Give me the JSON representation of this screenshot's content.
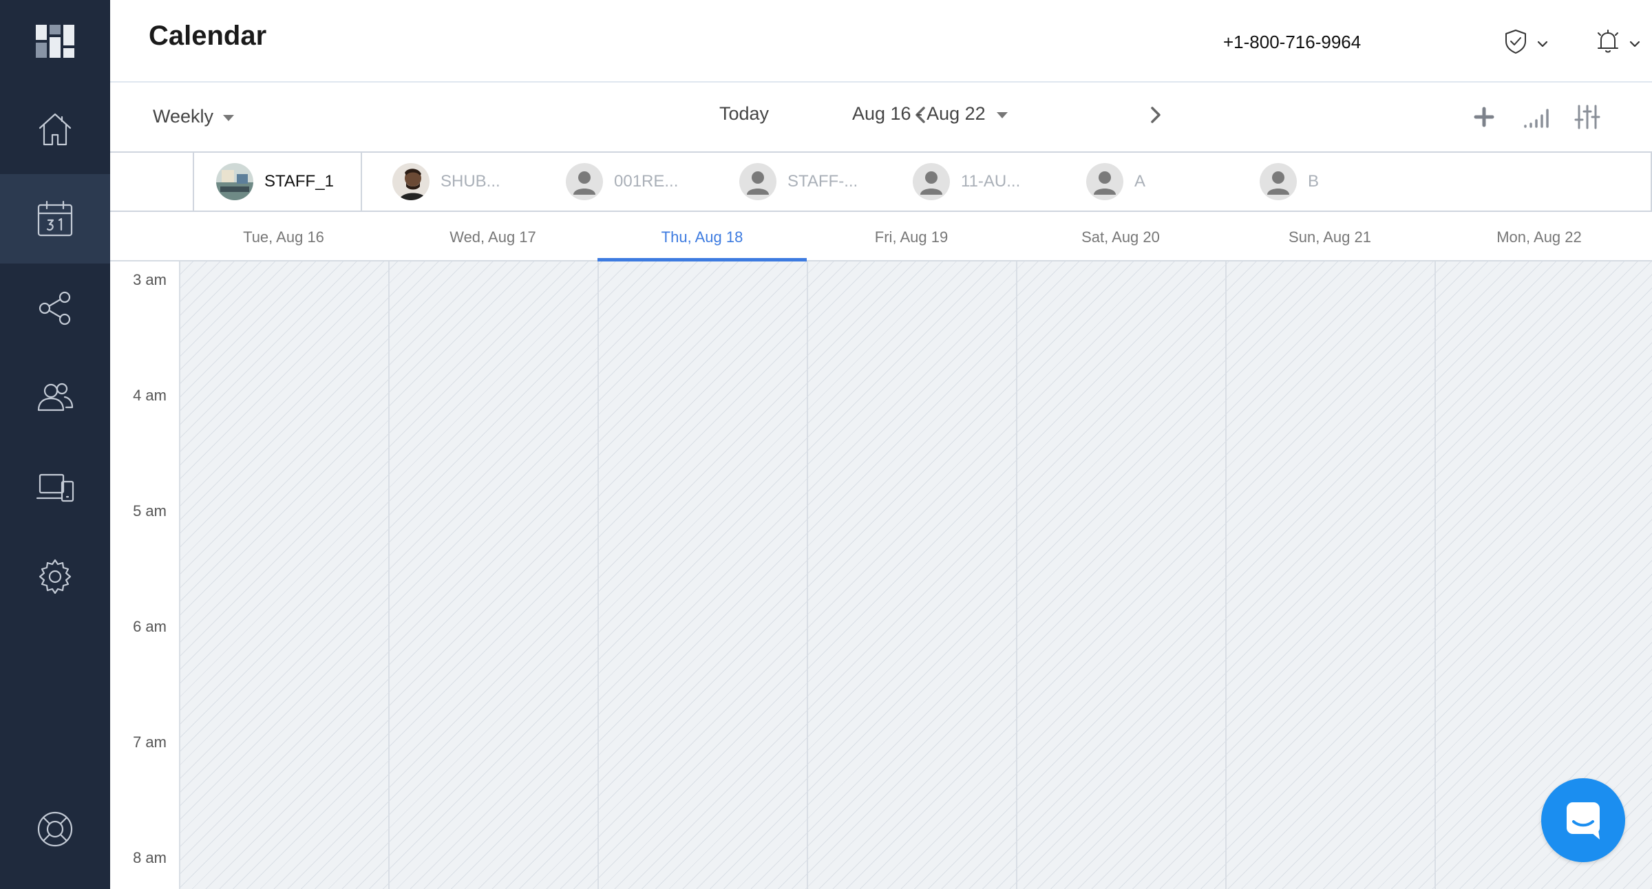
{
  "sidebar": {
    "items": [
      {
        "name": "home"
      },
      {
        "name": "calendar",
        "active": true
      },
      {
        "name": "share"
      },
      {
        "name": "customers"
      },
      {
        "name": "devices"
      },
      {
        "name": "settings"
      },
      {
        "name": "help"
      }
    ]
  },
  "header": {
    "title": "Calendar",
    "phone": "+1-800-716-9964"
  },
  "toolbar": {
    "view": "Weekly",
    "today_label": "Today",
    "range_label": "Aug 16 - Aug 22"
  },
  "staff": [
    {
      "label": "STAFF_1",
      "active": true
    },
    {
      "label": "SHUB..."
    },
    {
      "label": "001RE..."
    },
    {
      "label": "STAFF-..."
    },
    {
      "label": "11-AU..."
    },
    {
      "label": "A"
    },
    {
      "label": "B"
    }
  ],
  "days": [
    {
      "label": "Tue, Aug 16"
    },
    {
      "label": "Wed, Aug 17"
    },
    {
      "label": "Thu, Aug 18",
      "today": true
    },
    {
      "label": "Fri, Aug 19"
    },
    {
      "label": "Sat, Aug 20"
    },
    {
      "label": "Sun, Aug 21"
    },
    {
      "label": "Mon, Aug 22"
    }
  ],
  "times": [
    "3 am",
    "4 am",
    "5 am",
    "6 am",
    "7 am",
    "8 am"
  ],
  "colors": {
    "sidebar": "#1f2a3d",
    "sidebar_active": "#2c3a50",
    "accent": "#3d7be0",
    "chat": "#1b8ef0",
    "grid_bg": "#eff2f5"
  }
}
